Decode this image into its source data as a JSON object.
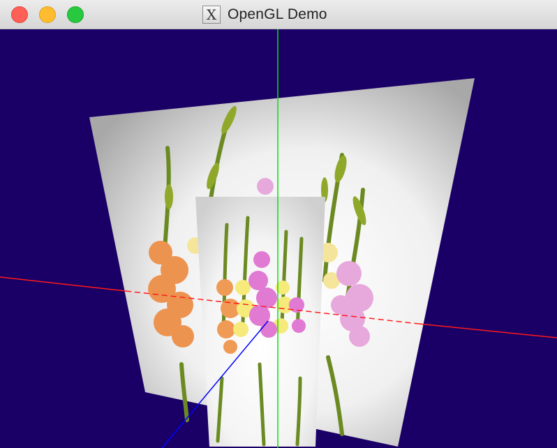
{
  "window": {
    "title": "OpenGL Demo",
    "controls": {
      "close": "close",
      "minimize": "minimize",
      "maximize": "maximize"
    },
    "app_icon": "x11-icon",
    "app_icon_glyph": "X"
  },
  "scene": {
    "background_color": "#1a0066",
    "axes": {
      "x_color": "#ff1a1a",
      "y_color": "#00e600",
      "z_color": "#0000ff"
    },
    "planes": [
      {
        "name": "back-plane",
        "texture": "gladiolus-flowers"
      },
      {
        "name": "front-plane",
        "texture": "gladiolus-flowers"
      }
    ]
  }
}
